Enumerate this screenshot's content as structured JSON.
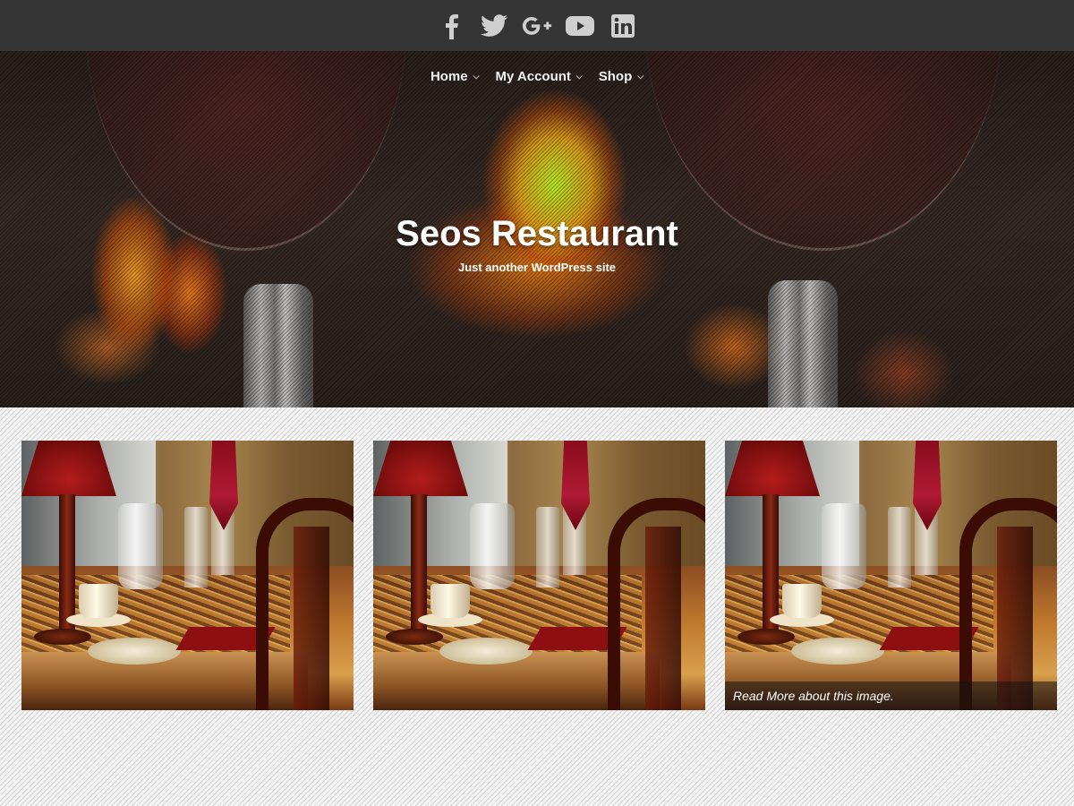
{
  "social": [
    {
      "name": "facebook"
    },
    {
      "name": "twitter"
    },
    {
      "name": "google-plus"
    },
    {
      "name": "youtube"
    },
    {
      "name": "linkedin"
    }
  ],
  "colors": {
    "social_bar_bg": "#353535",
    "social_icon": "#cfcfcf",
    "title_text": "#ffffff"
  },
  "nav": {
    "items": [
      {
        "label": "Home"
      },
      {
        "label": "My Account"
      },
      {
        "label": "Shop"
      }
    ]
  },
  "hero": {
    "title": "Seos Restaurant",
    "tagline": "Just another WordPress site"
  },
  "gallery": {
    "items": [
      {
        "caption": ""
      },
      {
        "caption": ""
      },
      {
        "caption": "Read More about this image."
      }
    ]
  }
}
